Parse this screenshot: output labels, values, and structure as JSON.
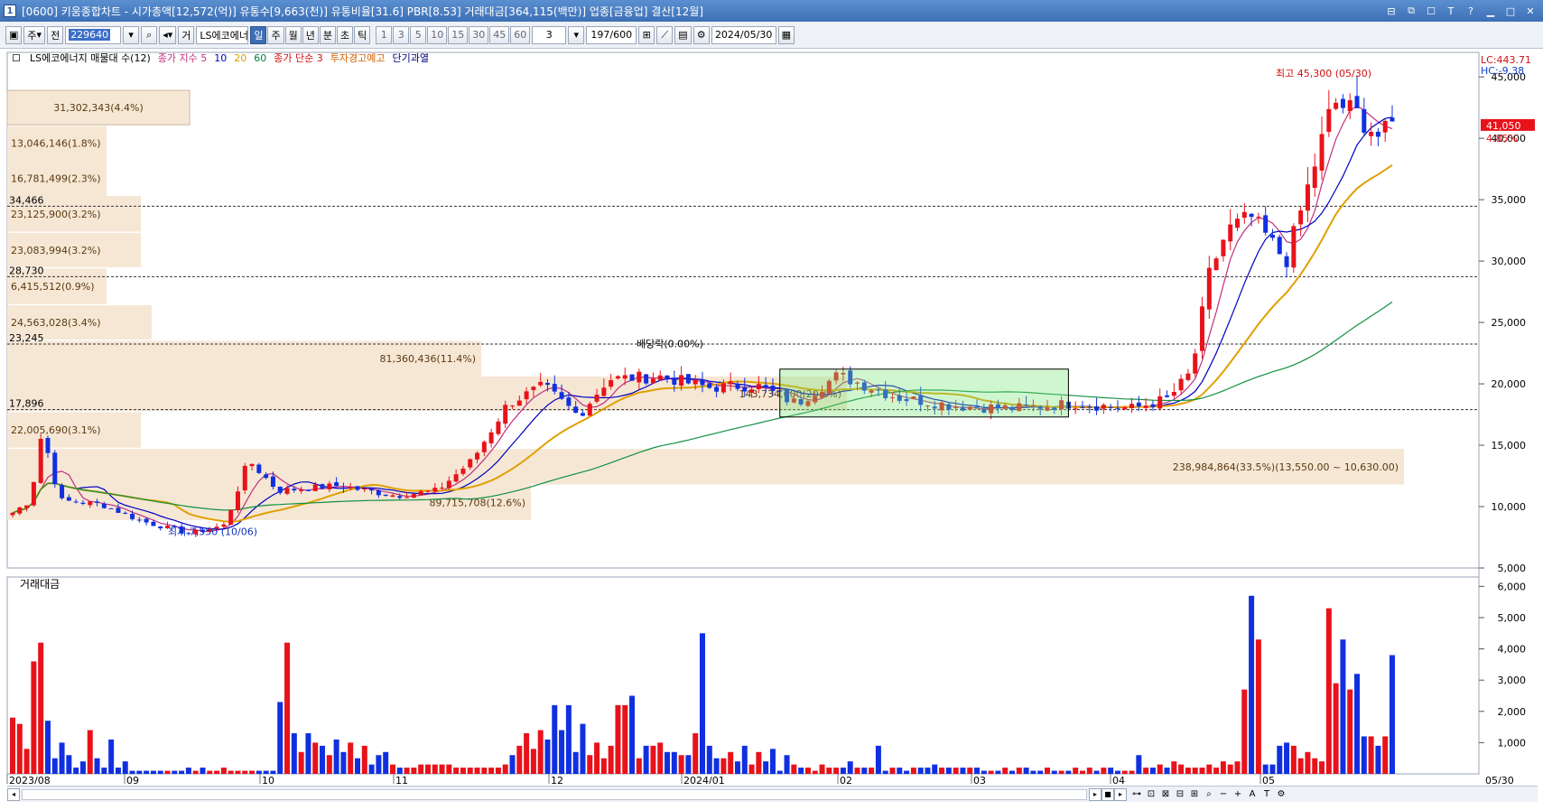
{
  "window": {
    "app_icon": "1",
    "title": "[0600] 키움종합차트 - 시가총액[12,572(억)] 유통수[9,663(천)] 유통비율[31.6] PBR[8.53] 거래대금[364,115(백만)] 업종[금융업] 결산[12월]",
    "buttons": [
      "layout-icon",
      "restore-icon",
      "maximize-icon",
      "font-icon",
      "help-icon",
      "minimize-icon",
      "max-icon",
      "close-icon"
    ]
  },
  "toolbar": {
    "type_select": "주",
    "full_label": "전",
    "code_value": "229640",
    "trade_label": "거",
    "stock_name": "LS에코에너",
    "periods": [
      "일",
      "주",
      "월",
      "년",
      "분",
      "초",
      "틱"
    ],
    "selected_period": "일",
    "minutes": [
      "1",
      "3",
      "5",
      "10",
      "15",
      "30",
      "45",
      "60"
    ],
    "unit_value": "3",
    "count_value": "197/600",
    "date_value": "2024/05/30"
  },
  "legend": {
    "items": [
      {
        "text": "LS에코에너지 매물대 수(12)",
        "color": "#000000"
      },
      {
        "text": "종가 지수 5",
        "color": "#c03080"
      },
      {
        "text": "10",
        "color": "#0000c0"
      },
      {
        "text": "20",
        "color": "#d4a000"
      },
      {
        "text": "60",
        "color": "#008040"
      },
      {
        "text": "종가 단순 3",
        "color": "#d01010"
      },
      {
        "text": "투자경고예고",
        "color": "#d06000"
      },
      {
        "text": "단기과열",
        "color": "#000080"
      }
    ]
  },
  "price_axis": {
    "top_labels": [
      "LC:443.71",
      "HC:-9.38"
    ],
    "current_price": "41,050",
    "current_change": "4.85%",
    "ticks": [
      "45,000",
      "40,000",
      "35,000",
      "30,000",
      "25,000",
      "20,000",
      "15,000",
      "10,000",
      "5,000"
    ],
    "reference_lines": [
      {
        "label": "34,466",
        "value": 34466
      },
      {
        "label": "28,730",
        "value": 28730
      },
      {
        "label": "23,245",
        "value": 23245
      },
      {
        "label": "17,896",
        "value": 17896
      }
    ]
  },
  "volume_profile": [
    {
      "label": "31,302,343(4.4%)"
    },
    {
      "label": "13,046,146(1.8%)"
    },
    {
      "label": "16,781,499(2.3%)"
    },
    {
      "label": "23,125,900(3.2%)"
    },
    {
      "label": "23,083,994(3.2%)"
    },
    {
      "label": "6,415,512(0.9%)"
    },
    {
      "label": "24,563,028(3.4%)"
    },
    {
      "label": "81,360,436(11.4%)"
    },
    {
      "label": "143,734,600(20.1%)"
    },
    {
      "label": "22,005,690(3.1%)"
    },
    {
      "label": "238,984,864(33.5%)(13,550.00 ~ 10,630.00)"
    },
    {
      "label": "89,715,708(12.6%)"
    }
  ],
  "annotations": {
    "high": "최고 45,300 (05/30)",
    "low": "최저 7,550 (10/06)",
    "dividend": "배당락(0.00%)"
  },
  "volume_pane": {
    "title": "거래대금",
    "ticks": [
      "6,000",
      "5,000",
      "4,000",
      "3,000",
      "2,000",
      "1,000"
    ]
  },
  "x_axis": {
    "labels": [
      "2023/08",
      "09",
      "10",
      "11",
      "12",
      "2024/01",
      "02",
      "03",
      "04",
      "05"
    ],
    "last_date": "05/30"
  },
  "colors": {
    "up": "#e8121a",
    "down": "#1030e0",
    "ma5": "#c03080",
    "ma10": "#0000c0",
    "ma20": "#e0a000",
    "ma60": "#109040",
    "profile": "#f6e7d5"
  },
  "chart_data": {
    "type": "candlestick",
    "y_range": [
      5000,
      47000
    ],
    "period": [
      "2023/08",
      "2024/05/30"
    ],
    "high": 45300,
    "low": 7550,
    "last_close": 41050,
    "volume_y_range": [
      0,
      6000
    ],
    "volume_values": [
      1800,
      1600,
      800,
      3600,
      4200,
      1700,
      500,
      1000,
      600,
      200,
      400,
      1400,
      500,
      200,
      1100,
      200,
      400,
      100,
      100,
      100,
      100,
      100,
      100,
      100,
      100,
      200,
      100,
      200,
      100,
      100,
      200,
      100,
      100,
      100,
      100,
      100,
      100,
      100,
      2300,
      4200,
      1300,
      700,
      1300,
      1000,
      900,
      600,
      1100,
      700,
      1000,
      500,
      900,
      300,
      600,
      700,
      300,
      200,
      200,
      200,
      300,
      300,
      300,
      300,
      300,
      200,
      200,
      200,
      200,
      200,
      200,
      200,
      300,
      600,
      900,
      1300,
      800,
      1400,
      1100,
      2200,
      1400,
      2200,
      700,
      1600,
      600,
      1000,
      500,
      900,
      2200,
      2200,
      2500,
      500,
      900,
      900,
      1000,
      700,
      700,
      600,
      600,
      1300,
      4500,
      900,
      500,
      500,
      700,
      400,
      900,
      300,
      700,
      400,
      800,
      100,
      600,
      300,
      200,
      200,
      100,
      300,
      200,
      200,
      200,
      400,
      200,
      200,
      200,
      900,
      100,
      200,
      200,
      100,
      200,
      200,
      200,
      300,
      200,
      200,
      200,
      200,
      200,
      200,
      100,
      100,
      100,
      200,
      100,
      200,
      200,
      100,
      100,
      200,
      100,
      100,
      100,
      200,
      100,
      200,
      100,
      200,
      200,
      100,
      100,
      100,
      600,
      200,
      200,
      300,
      200,
      400,
      300,
      200,
      200,
      200,
      300,
      200,
      400,
      300,
      400,
      2700,
      5700,
      4300,
      300,
      300,
      900,
      1000,
      900,
      500,
      700,
      500,
      400,
      5300,
      2900,
      4300,
      2700,
      3200,
      1200,
      1200,
      900,
      1200,
      3800
    ]
  }
}
